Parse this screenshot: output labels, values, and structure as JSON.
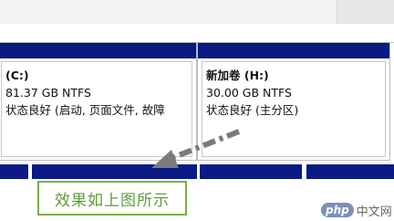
{
  "partitions": [
    {
      "name": "(C:)",
      "size_fs": "81.37 GB NTFS",
      "status": "状态良好 (启动, 页面文件, 故障"
    },
    {
      "name": "新加卷 (H:)",
      "size_fs": "30.00 GB NTFS",
      "status": "状态良好 (主分区)"
    }
  ],
  "caption": "效果如上图所示",
  "watermark": {
    "logo": "php",
    "text": "中文网"
  },
  "colors": {
    "partition_bar": "#0b1a84",
    "caption_border": "#7ab047",
    "caption_text": "#5e9c34",
    "arrow": "#7a7a7a"
  }
}
